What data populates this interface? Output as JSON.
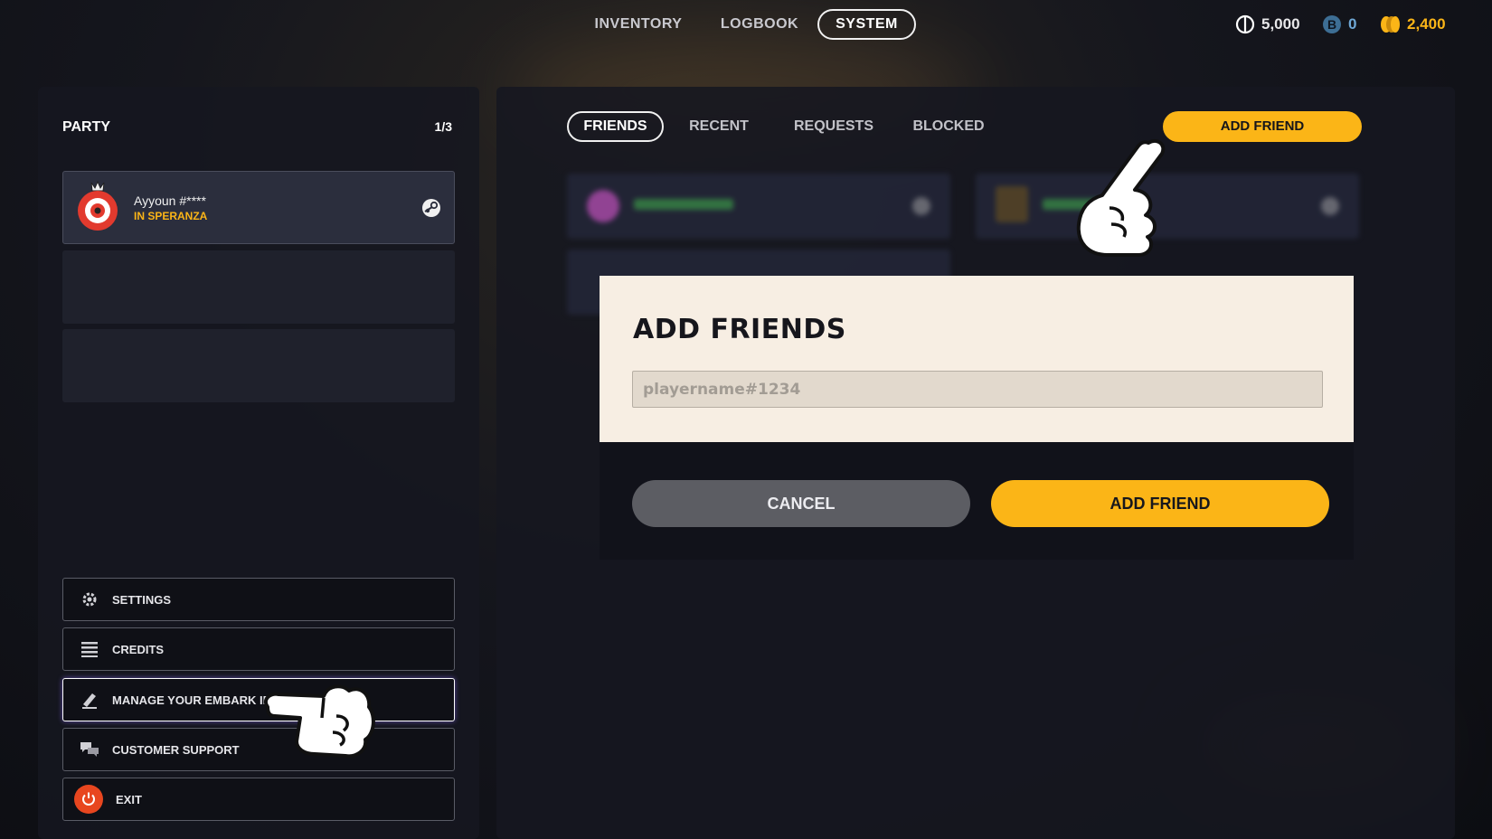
{
  "nav": {
    "tabs": [
      {
        "label": "INVENTORY",
        "active": false
      },
      {
        "label": "LOGBOOK",
        "active": false
      },
      {
        "label": "SYSTEM",
        "active": true
      }
    ]
  },
  "currencies": [
    {
      "icon": "vbucks-coin-icon",
      "value": "5,000",
      "color": "#ffffff"
    },
    {
      "icon": "b-token-icon",
      "value": "0",
      "color": "#6fa8d6"
    },
    {
      "icon": "gold-coins-icon",
      "value": "2,400",
      "color": "#fbb517"
    }
  ],
  "party": {
    "title": "PARTY",
    "count": "1/3",
    "member": {
      "name": "Ayyoun #****",
      "status": "IN SPERANZA",
      "status_color": "#fbb517",
      "platform_icon": "steam-icon"
    }
  },
  "menu": [
    {
      "label": "SETTINGS",
      "icon": "gear-icon"
    },
    {
      "label": "CREDITS",
      "icon": "list-icon"
    },
    {
      "label": "MANAGE YOUR EMBARK ID",
      "icon": "edit-icon"
    },
    {
      "label": "CUSTOMER SUPPORT",
      "icon": "chat-icon"
    },
    {
      "label": "EXIT",
      "icon": "power-icon"
    }
  ],
  "friends": {
    "tabs": [
      {
        "label": "FRIENDS",
        "active": true
      },
      {
        "label": "RECENT",
        "active": false
      },
      {
        "label": "REQUESTS",
        "active": false
      },
      {
        "label": "BLOCKED",
        "active": false
      }
    ],
    "add_button": "ADD FRIEND"
  },
  "modal": {
    "title": "ADD FRIENDS",
    "input_placeholder": "playername#1234",
    "input_value": "",
    "cancel": "CANCEL",
    "confirm": "ADD FRIEND"
  },
  "colors": {
    "accent": "#fbb517",
    "modal_bg": "#f7eee3",
    "exit_red": "#e8461f"
  }
}
